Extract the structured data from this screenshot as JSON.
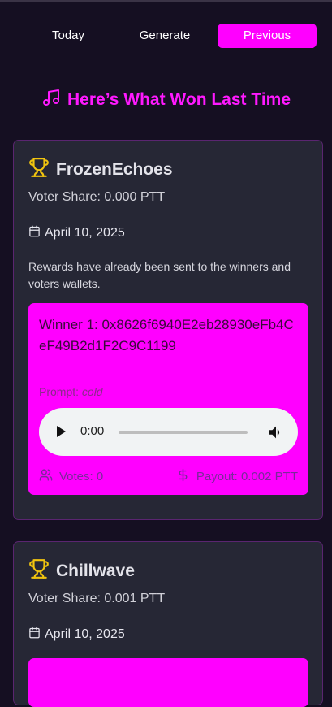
{
  "tabs": {
    "today": "Today",
    "generate": "Generate",
    "previous": "Previous"
  },
  "heading": "Here’s What Won Last Time",
  "cards": [
    {
      "title": "FrozenEchoes",
      "voter_share": "Voter Share: 0.000 PTT",
      "date": "April 10, 2025",
      "note": "Rewards have already been sent to the winners and voters wallets.",
      "winner": {
        "label": "Winner 1: 0x8626f6940E2eb28930eFb4CeF49B2d1F2C9C1199",
        "prompt_label": "Prompt:",
        "prompt_value": "cold",
        "time": "0:00",
        "votes": "Votes: 0",
        "payout": "Payout: 0.002 PTT"
      }
    },
    {
      "title": "Chillwave",
      "voter_share": "Voter Share: 0.001 PTT",
      "date": "April 10, 2025"
    }
  ],
  "colors": {
    "accent": "#ff00ff",
    "background": "#150f22",
    "card": "#262735",
    "trophy": "#f1c40f"
  }
}
